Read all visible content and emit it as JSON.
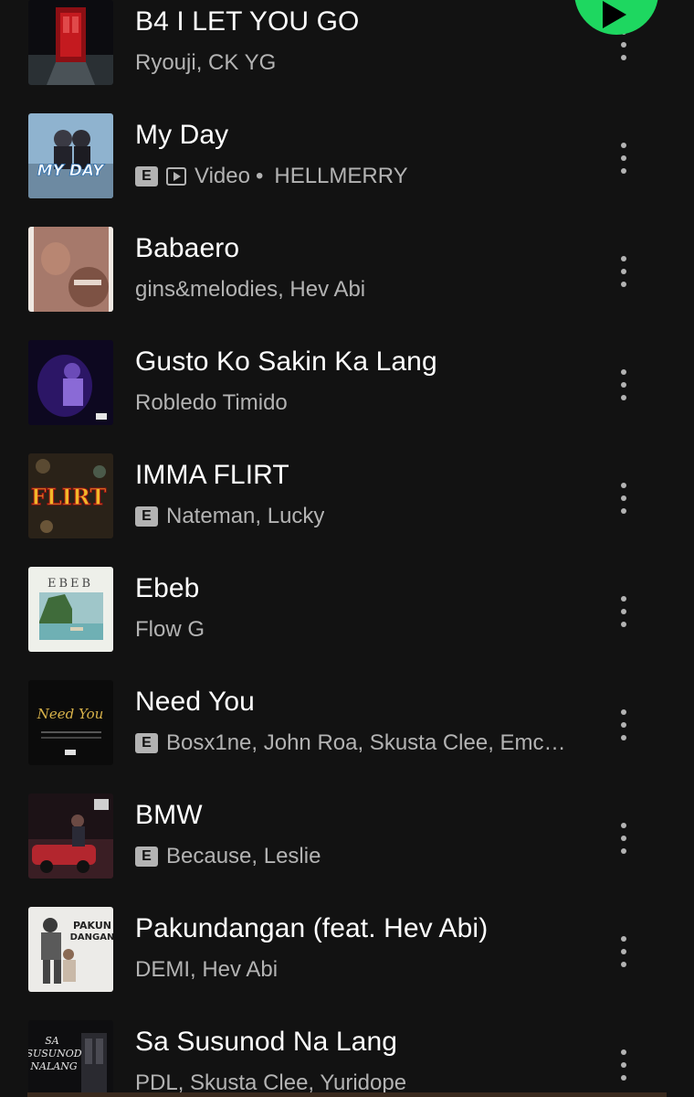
{
  "play_button": {
    "icon": "play-icon",
    "color": "#1ed760"
  },
  "tracks": [
    {
      "title": "B4 I LET YOU GO",
      "artists": "Ryouji, CK YG",
      "explicit": false,
      "video": false,
      "cover": "red-door"
    },
    {
      "title": "My Day",
      "artists": "HELLMERRY",
      "explicit": true,
      "video": true,
      "video_label": "Video",
      "separator": "•",
      "cover": "my-day"
    },
    {
      "title": "Babaero",
      "artists": "gins&melodies, Hev Abi",
      "explicit": false,
      "video": false,
      "cover": "babaero"
    },
    {
      "title": "Gusto Ko Sakin Ka Lang",
      "artists": "Robledo Timido",
      "explicit": false,
      "video": false,
      "cover": "purple"
    },
    {
      "title": "IMMA FLIRT",
      "artists": "Nateman, Lucky",
      "explicit": true,
      "video": false,
      "cover": "flirt"
    },
    {
      "title": "Ebeb",
      "artists": "Flow G",
      "explicit": false,
      "video": false,
      "cover": "ebeb"
    },
    {
      "title": "Need You",
      "artists": "Bosx1ne, John Roa, Skusta Clee, Emc…",
      "explicit": true,
      "video": false,
      "cover": "need-you"
    },
    {
      "title": "BMW",
      "artists": "Because, Leslie",
      "explicit": true,
      "video": false,
      "cover": "bmw"
    },
    {
      "title": "Pakundangan (feat. Hev Abi)",
      "artists": "DEMI, Hev Abi",
      "explicit": false,
      "video": false,
      "cover": "pakundangan"
    },
    {
      "title": "Sa Susunod Na Lang",
      "artists": "PDL, Skusta Clee, Yuridope",
      "explicit": false,
      "video": false,
      "cover": "sa-susunod"
    }
  ],
  "labels": {
    "explicit": "E"
  },
  "cover_art": {
    "ebeb": "EBEB",
    "need_you": "Need You",
    "flirt": "FLIRT",
    "my_day": "MY DAY",
    "pakundangan_1": "PAKUN",
    "pakundangan_2": "DANGAN",
    "sa_susunod_1": "SA",
    "sa_susunod_2": "SUSUNOD",
    "sa_susunod_3": "NALANG"
  }
}
